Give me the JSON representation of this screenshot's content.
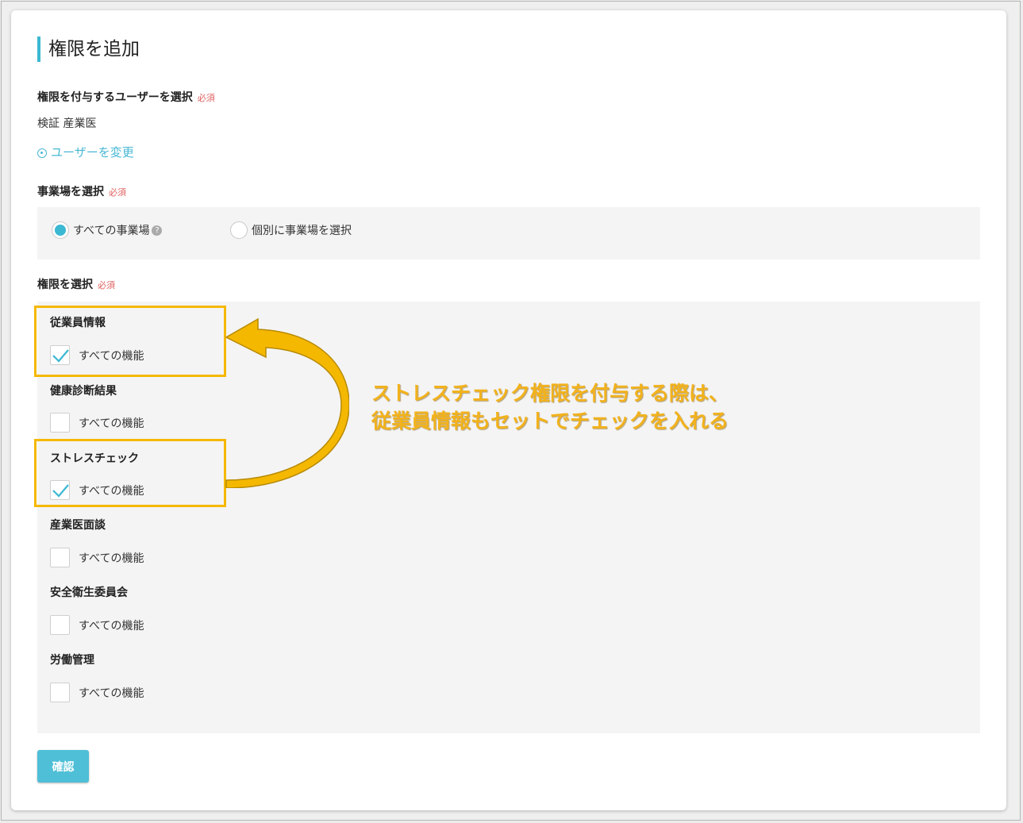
{
  "page": {
    "title": "権限を追加"
  },
  "user_section": {
    "label": "権限を付与するユーザーを選択",
    "required": "必須",
    "selected_user": "検証 産業医",
    "change_link": "ユーザーを変更"
  },
  "site_section": {
    "label": "事業場を選択",
    "required": "必須",
    "options": [
      {
        "label": "すべての事業場",
        "selected": true
      },
      {
        "label": "個別に事業場を選択",
        "selected": false
      }
    ]
  },
  "permission_section": {
    "label": "権限を選択",
    "required": "必須",
    "categories": [
      {
        "name": "従業員情報",
        "option": "すべての機能",
        "checked": true
      },
      {
        "name": "健康診断結果",
        "option": "すべての機能",
        "checked": false
      },
      {
        "name": "ストレスチェック",
        "option": "すべての機能",
        "checked": true
      },
      {
        "name": "産業医面談",
        "option": "すべての機能",
        "checked": false
      },
      {
        "name": "安全衛生委員会",
        "option": "すべての機能",
        "checked": false
      },
      {
        "name": "労働管理",
        "option": "すべての機能",
        "checked": false
      }
    ]
  },
  "annotation": {
    "line1": "ストレスチェック権限を付与する際は、",
    "line2": "従業員情報もセットでチェックを入れる"
  },
  "confirm_button": "確認",
  "colors": {
    "accent": "#3bb8d2",
    "highlight": "#f5b800",
    "callout_text": "#f2b21c",
    "required": "#e06060"
  }
}
